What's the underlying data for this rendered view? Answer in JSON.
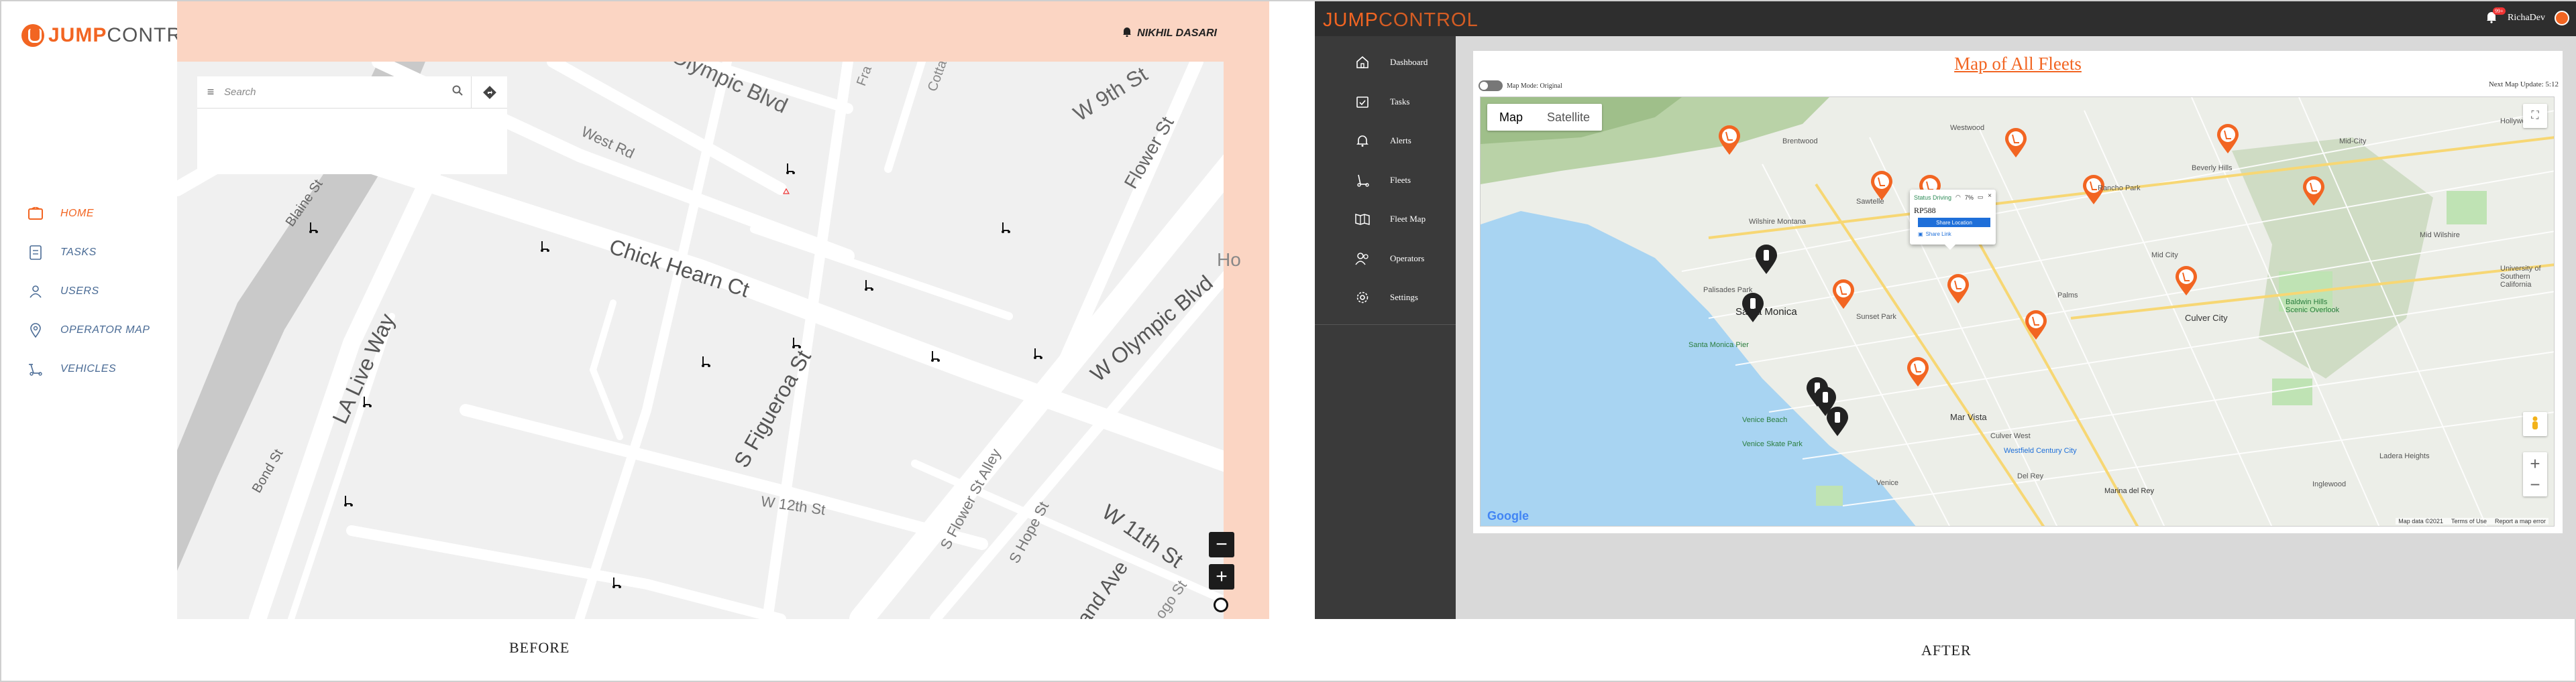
{
  "before": {
    "logo": {
      "part1": "JUMP",
      "part2": "CONTROL"
    },
    "user": "NIKHIL DASARI",
    "nav": [
      {
        "label": "HOME",
        "icon": "home-icon",
        "active": true
      },
      {
        "label": "TASKS",
        "icon": "task-icon",
        "active": false
      },
      {
        "label": "USERS",
        "icon": "user-icon",
        "active": false
      },
      {
        "label": "OPERATOR MAP",
        "icon": "map-pin-icon",
        "active": false
      },
      {
        "label": "VEHICLES",
        "icon": "scooter-icon",
        "active": false
      }
    ],
    "search": {
      "placeholder": "Search"
    },
    "map": {
      "streets": [
        "Olympic Blvd",
        "W 9th St",
        "West Rd",
        "Flower St",
        "Chick Hearn Ct",
        "W Olympic Blvd",
        "Blaine St",
        "LA Live Way",
        "S Figueroa St",
        "S Flower St Alley",
        "S Hope St",
        "W 12th St",
        "W 11th St",
        "Grand Ave",
        "Bond St",
        "Fra",
        "Cotta",
        "Ho",
        "ogo St"
      ],
      "zoom_out": "−",
      "zoom_in": "+"
    },
    "caption": "BEFORE"
  },
  "after": {
    "logo": {
      "part1": "JUMP",
      "part2": "CONTROL"
    },
    "user": "RichaDev",
    "notif_count": "99+",
    "nav": [
      {
        "label": "Dashboard",
        "icon": "home-icon"
      },
      {
        "label": "Tasks",
        "icon": "calendar-check-icon"
      },
      {
        "label": "Alerts",
        "icon": "bell-icon"
      },
      {
        "label": "Fleets",
        "icon": "scooter-icon"
      },
      {
        "label": "Fleet Map",
        "icon": "book-map-icon"
      },
      {
        "label": "Operators",
        "icon": "operators-icon"
      },
      {
        "label": "Settings",
        "icon": "gear-icon"
      }
    ],
    "toggle_label": "Map Mode: Original",
    "title": "Map of All Fleets",
    "last_update": "Next Map Update: 5:12",
    "map_type": {
      "map": "Map",
      "satellite": "Satellite"
    },
    "popup": {
      "status": "Status Driving",
      "battery": "7%",
      "id": "RP588",
      "button": "Share Location",
      "link": "Share Link"
    },
    "places": [
      "Santa Monica",
      "Palisades Park",
      "Santa Monica Pier",
      "Venice Beach",
      "Venice Skate Park",
      "Westfield Century City",
      "Culver City",
      "Marina del Rey",
      "University of Southern California",
      "Beverly Hills",
      "Mid City",
      "Ladera Heights",
      "Inglewood",
      "Hollywood",
      "Brentwood",
      "Westwood",
      "Mar Vista",
      "Del Rey",
      "Palms",
      "Venice",
      "Culver West",
      "Sunset Park",
      "Sawtelle",
      "Rancho Park",
      "Mid-City",
      "Baldwin Hills Scenic Overlook",
      "Wilshire Montana",
      "Mid Wilshire"
    ],
    "google": "Google",
    "map_footer": [
      "Map data ©2021",
      "Terms of Use",
      "Report a map error"
    ],
    "caption": "AFTER"
  },
  "colors": {
    "accent": "#f26522",
    "before_header": "#fbd5c3",
    "after_sidebar": "#3a3a3a",
    "water": "#a8d4f2",
    "park": "#bfe3b4"
  }
}
